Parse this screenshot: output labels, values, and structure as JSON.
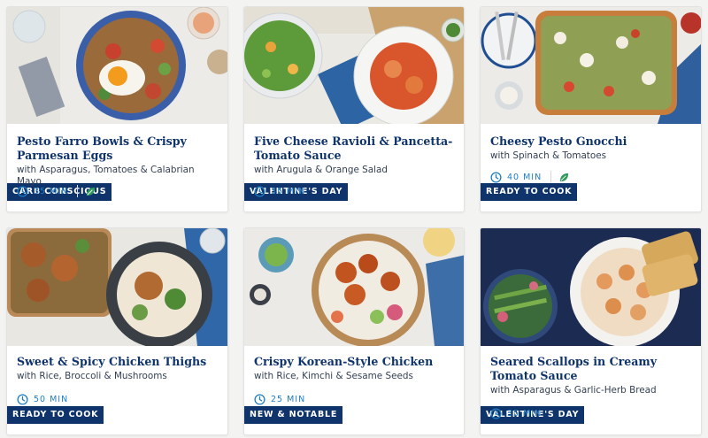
{
  "colors": {
    "badge_bg": "#0f346c",
    "title": "#0f346c",
    "time": "#1d7dc4",
    "leaf": "#2e9a5a"
  },
  "recipes": [
    {
      "badge": "CARB CONSCIOUS",
      "title": "Pesto Farro Bowls & Crispy Parmesan Eggs",
      "subtitle": "with Asparagus, Tomatoes & Calabrian Mayo",
      "time": "35 MIN",
      "icons": [
        "clock-icon",
        "leaf-icon"
      ]
    },
    {
      "badge": "VALENTINE'S DAY",
      "title": "Five Cheese Ravioli & Pancetta-Tomato Sauce",
      "subtitle": "with Arugula & Orange Salad",
      "time": "35 MIN",
      "icons": [
        "clock-icon"
      ]
    },
    {
      "badge": "READY TO COOK",
      "title": "Cheesy Pesto Gnocchi",
      "subtitle": "with Spinach & Tomatoes",
      "time": "40 MIN",
      "icons": [
        "clock-icon",
        "leaf-icon"
      ]
    },
    {
      "badge": "READY TO COOK",
      "title": "Sweet & Spicy Chicken Thighs",
      "subtitle": "with Rice, Broccoli & Mushrooms",
      "time": "50 MIN",
      "icons": [
        "clock-icon"
      ]
    },
    {
      "badge": "NEW & NOTABLE",
      "title": "Crispy Korean-Style Chicken",
      "subtitle": "with Rice, Kimchi & Sesame Seeds",
      "time": "25 MIN",
      "icons": [
        "clock-icon"
      ]
    },
    {
      "badge": "VALENTINE'S DAY",
      "title": "Seared Scallops in Creamy Tomato Sauce",
      "subtitle": "with Asparagus & Garlic-Herb Bread",
      "time": "35 MIN",
      "icons": [
        "clock-icon"
      ]
    }
  ]
}
